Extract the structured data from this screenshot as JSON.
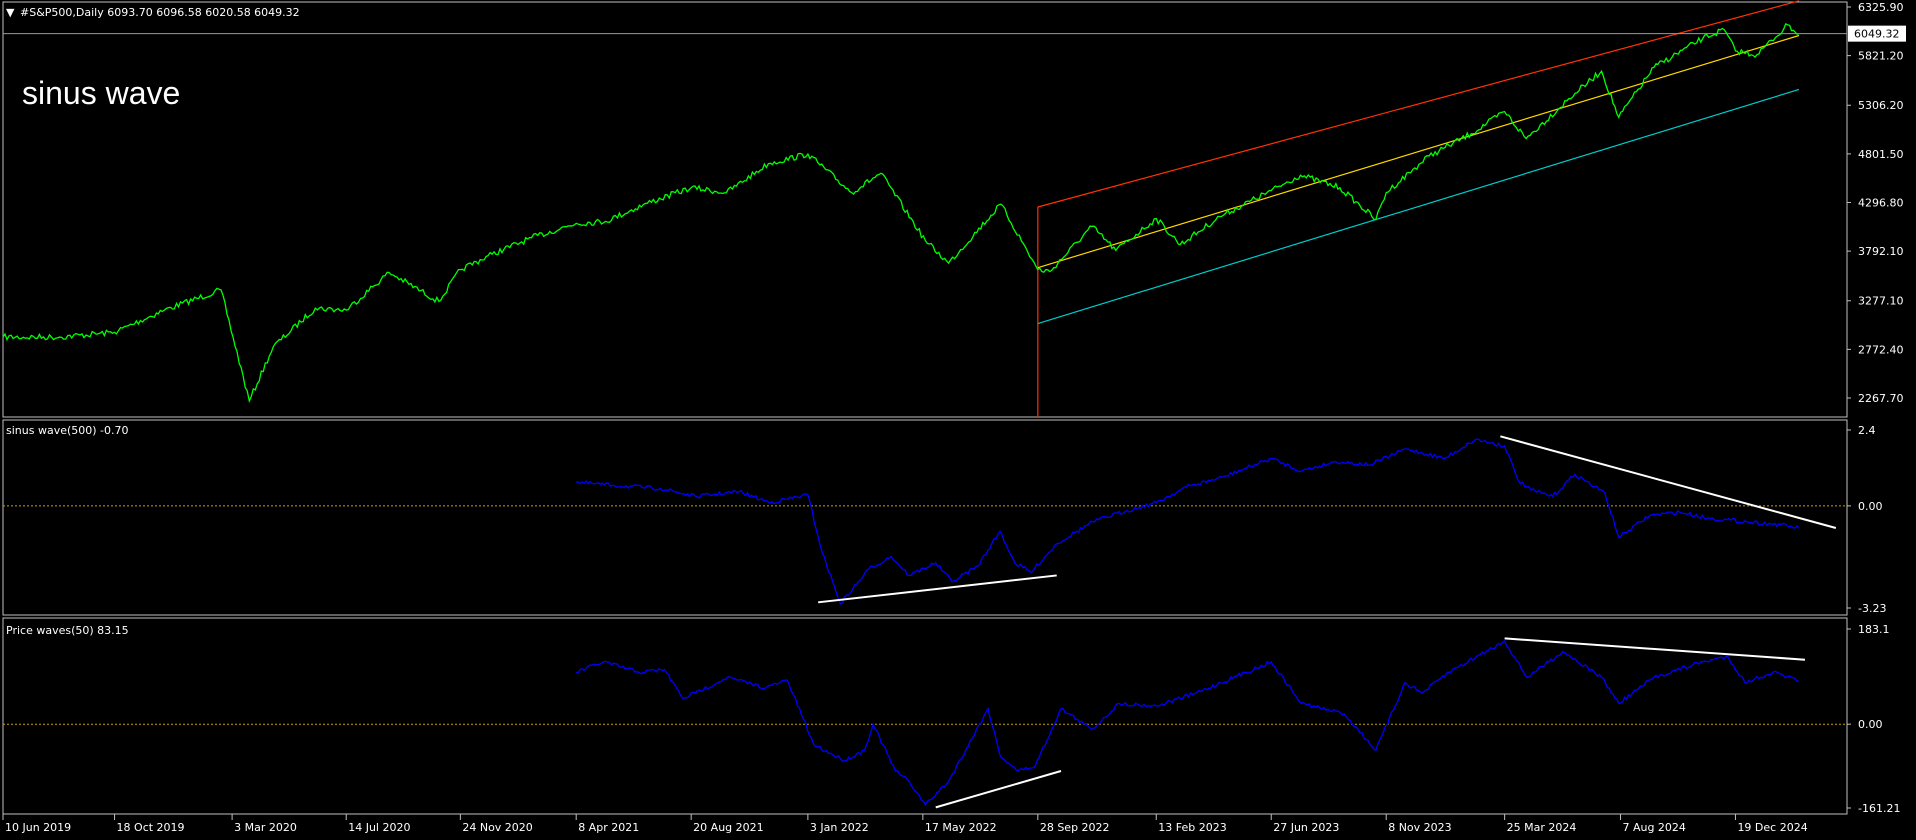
{
  "header": {
    "symbol_line": "#S&P500,Daily  6093.70 6096.58 6020.58 6049.32",
    "annotation": "sinus wave",
    "current_price_label": "6049.32"
  },
  "colors": {
    "background": "#000000",
    "frame": "#c0c0c0",
    "price": "#00ff00",
    "indicator": "#0000ff",
    "zero_line": "#c8a000",
    "trend_lines": "#ffffff",
    "channel_upper": "#ff3300",
    "channel_mid": "#ffd700",
    "channel_lower": "#00cccc",
    "vertical_marker": "#ff3300"
  },
  "chart_data": [
    {
      "type": "line",
      "panel": "price",
      "title": "#S&P500,Daily",
      "ylim": [
        2267.7,
        6325.9
      ],
      "yticks": [
        "6325.90",
        "5821.20",
        "5306.20",
        "4801.50",
        "4296.80",
        "3792.10",
        "3277.10",
        "2772.40",
        "2267.70"
      ],
      "current_value": 6049.32,
      "series": [
        {
          "x": [
            "2019-06-10",
            "2019-08-15",
            "2019-10-18",
            "2019-12-15",
            "2020-02-19",
            "2020-03-23",
            "2020-04-20",
            "2020-06-08",
            "2020-07-14",
            "2020-09-02",
            "2020-10-30",
            "2020-11-24",
            "2020-12-31",
            "2021-02-15",
            "2021-04-08",
            "2021-05-12",
            "2021-06-30",
            "2021-08-20",
            "2021-09-30",
            "2021-11-18",
            "2022-01-03",
            "2022-02-23",
            "2022-03-29",
            "2022-05-20",
            "2022-06-16",
            "2022-08-16",
            "2022-09-28",
            "2022-10-12",
            "2022-11-30",
            "2022-12-28",
            "2023-02-13",
            "2023-03-13",
            "2023-04-28",
            "2023-06-27",
            "2023-07-31",
            "2023-09-15",
            "2023-10-27",
            "2023-11-08",
            "2023-12-28",
            "2024-02-15",
            "2024-03-25",
            "2024-04-19",
            "2024-06-15",
            "2024-07-16",
            "2024-08-05",
            "2024-09-15",
            "2024-11-11",
            "2024-12-06",
            "2024-12-19",
            "2025-01-13",
            "2025-02-18",
            "2025-03-03"
          ],
          "y": [
            2900,
            2900,
            2950,
            3180,
            3390,
            2237,
            2800,
            3200,
            3180,
            3570,
            3270,
            3600,
            3760,
            3930,
            4080,
            4100,
            4290,
            4450,
            4400,
            4700,
            4800,
            4400,
            4600,
            3900,
            3667,
            4280,
            3600,
            3580,
            4050,
            3800,
            4130,
            3860,
            4150,
            4420,
            4580,
            4450,
            4120,
            4400,
            4780,
            5010,
            5240,
            4960,
            5430,
            5660,
            5180,
            5700,
            6000,
            6090,
            5870,
            5830,
            6140,
            6049
          ]
        }
      ],
      "channel": {
        "start": "2022-09-28",
        "end": "2025-03-03",
        "upper": [
          4250,
          6390
        ],
        "middle": [
          3620,
          6030
        ],
        "lower": [
          3040,
          5470
        ]
      }
    },
    {
      "type": "line",
      "panel": "indicator",
      "title": "sinus wave(500) -0.70",
      "ylim": [
        -3.23,
        2.4
      ],
      "yticks": [
        "2.4",
        "0.00",
        "-3.23"
      ],
      "reference_line": 0,
      "series": [
        {
          "x": [
            "2021-04-08",
            "2021-05-20",
            "2021-07-15",
            "2021-08-25",
            "2021-10-15",
            "2021-11-20",
            "2022-01-03",
            "2022-01-20",
            "2022-02-10",
            "2022-03-15",
            "2022-04-10",
            "2022-05-01",
            "2022-06-01",
            "2022-06-20",
            "2022-07-20",
            "2022-08-15",
            "2022-09-01",
            "2022-09-20",
            "2022-10-20",
            "2022-12-01",
            "2023-01-10",
            "2023-02-13",
            "2023-03-20",
            "2023-05-01",
            "2023-06-27",
            "2023-08-01",
            "2023-09-10",
            "2023-10-20",
            "2023-12-01",
            "2024-01-15",
            "2024-02-20",
            "2024-03-25",
            "2024-04-10",
            "2024-04-25",
            "2024-05-20",
            "2024-06-15",
            "2024-07-20",
            "2024-08-05",
            "2024-09-10",
            "2024-10-15",
            "2024-11-20",
            "2025-01-01",
            "2025-02-10",
            "2025-03-03"
          ],
          "y": [
            0.75,
            0.65,
            0.55,
            0.3,
            0.45,
            0.1,
            0.35,
            -1.5,
            -3.1,
            -2.0,
            -1.6,
            -2.2,
            -1.8,
            -2.4,
            -1.9,
            -0.8,
            -1.8,
            -2.1,
            -1.2,
            -0.5,
            -0.15,
            0.1,
            0.6,
            0.9,
            1.5,
            1.1,
            1.4,
            1.3,
            1.8,
            1.5,
            2.1,
            1.9,
            0.8,
            0.5,
            0.3,
            1.0,
            0.4,
            -1.0,
            -0.3,
            -0.2,
            -0.4,
            -0.5,
            -0.6,
            -0.7
          ]
        }
      ],
      "trend_lines": [
        {
          "x": [
            "2022-01-15",
            "2022-10-20"
          ],
          "y": [
            -3.05,
            -2.2
          ]
        },
        {
          "x": [
            "2024-03-20",
            "2025-04-15"
          ],
          "y": [
            2.2,
            -0.7
          ]
        }
      ]
    },
    {
      "type": "line",
      "panel": "indicator",
      "title": "Price waves(50) 83.15",
      "ylim": [
        -161.21,
        183.1
      ],
      "yticks": [
        "183.1",
        "0.00",
        "-161.21"
      ],
      "reference_line": 0,
      "series": [
        {
          "x": [
            "2021-04-08",
            "2021-05-10",
            "2021-06-20",
            "2021-07-20",
            "2021-08-10",
            "2021-08-25",
            "2021-10-01",
            "2021-11-15",
            "2021-12-10",
            "2022-01-10",
            "2022-02-15",
            "2022-03-10",
            "2022-03-20",
            "2022-04-15",
            "2022-05-01",
            "2022-05-20",
            "2022-06-16",
            "2022-08-01",
            "2022-08-15",
            "2022-09-05",
            "2022-09-25",
            "2022-10-25",
            "2022-11-30",
            "2023-01-01",
            "2023-02-13",
            "2023-04-01",
            "2023-06-27",
            "2023-08-01",
            "2023-09-20",
            "2023-10-27",
            "2023-11-30",
            "2023-12-20",
            "2024-01-20",
            "2024-03-25",
            "2024-04-20",
            "2024-06-01",
            "2024-07-16",
            "2024-08-05",
            "2024-09-15",
            "2024-11-11",
            "2024-12-10",
            "2024-12-30",
            "2025-02-01",
            "2025-03-03"
          ],
          "y": [
            100,
            120,
            100,
            105,
            50,
            60,
            90,
            70,
            85,
            -40,
            -70,
            -50,
            0,
            -90,
            -110,
            -155,
            -110,
            30,
            -60,
            -90,
            -80,
            30,
            -10,
            40,
            35,
            60,
            120,
            40,
            20,
            -50,
            80,
            60,
            100,
            160,
            90,
            140,
            90,
            40,
            90,
            120,
            130,
            80,
            100,
            83
          ]
        }
      ],
      "trend_lines": [
        {
          "x": [
            "2022-06-01",
            "2022-10-25"
          ],
          "y": [
            -160,
            -90
          ]
        },
        {
          "x": [
            "2024-03-25",
            "2025-03-10"
          ],
          "y": [
            165,
            124
          ]
        }
      ]
    }
  ],
  "x_axis": {
    "start": "2019-06-10",
    "end": "2025-04-28",
    "ticks": [
      {
        "d": "2019-06-10",
        "label": "10 Jun 2019"
      },
      {
        "d": "2019-10-18",
        "label": "18 Oct 2019"
      },
      {
        "d": "2020-03-03",
        "label": "3 Mar 2020"
      },
      {
        "d": "2020-07-14",
        "label": "14 Jul 2020"
      },
      {
        "d": "2020-11-24",
        "label": "24 Nov 2020"
      },
      {
        "d": "2021-04-08",
        "label": "8 Apr 2021"
      },
      {
        "d": "2021-08-20",
        "label": "20 Aug 2021"
      },
      {
        "d": "2022-01-03",
        "label": "3 Jan 2022"
      },
      {
        "d": "2022-05-17",
        "label": "17 May 2022"
      },
      {
        "d": "2022-09-28",
        "label": "28 Sep 2022"
      },
      {
        "d": "2023-02-13",
        "label": "13 Feb 2023"
      },
      {
        "d": "2023-06-27",
        "label": "27 Jun 2023"
      },
      {
        "d": "2023-11-08",
        "label": "8 Nov 2023"
      },
      {
        "d": "2024-03-25",
        "label": "25 Mar 2024"
      },
      {
        "d": "2024-08-07",
        "label": "7 Aug 2024"
      },
      {
        "d": "2024-12-19",
        "label": "19 Dec 2024"
      }
    ]
  }
}
